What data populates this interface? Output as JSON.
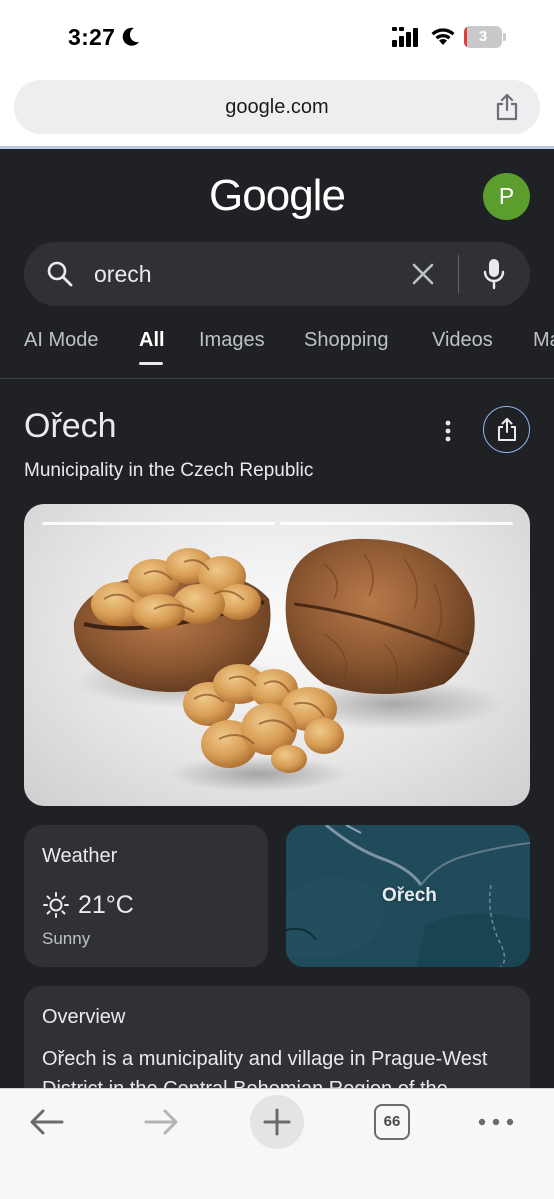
{
  "status_bar": {
    "time": "3:27",
    "battery_level": "3",
    "battery_fraction": 0.03
  },
  "browser": {
    "url": "google.com",
    "tab_count": "66"
  },
  "google": {
    "logo": "Google",
    "avatar_initial": "P",
    "avatar_color": "#5b9e2d",
    "search_query": "orech",
    "tabs": [
      {
        "label": "AI Mode",
        "active": false
      },
      {
        "label": "All",
        "active": true
      },
      {
        "label": "Images",
        "active": false
      },
      {
        "label": "Shopping",
        "active": false
      },
      {
        "label": "Videos",
        "active": false
      },
      {
        "label": "Ma",
        "active": false
      }
    ]
  },
  "knowledge_panel": {
    "title": "Ořech",
    "subtitle": "Municipality in the Czech Republic",
    "image_slides": 2,
    "active_slide": 1
  },
  "weather": {
    "title": "Weather",
    "temperature": "21°C",
    "condition": "Sunny",
    "icon": "sun-icon"
  },
  "map": {
    "label": "Ořech"
  },
  "overview": {
    "title": "Overview",
    "text": "Ořech is a municipality and village in Prague-West District in the Central Bohemian Region of the"
  },
  "colors": {
    "content_bg": "#202124",
    "card_bg": "#303134",
    "accent_link": "#8ab4f8",
    "battery_low": "#e53935"
  }
}
